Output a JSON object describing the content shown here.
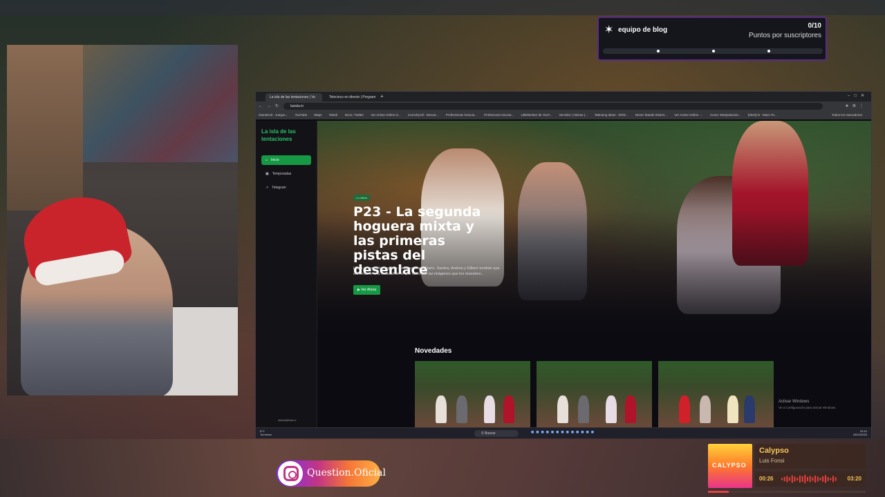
{
  "points_widget": {
    "title": "equipo de blog",
    "count": "0/10",
    "subtitle": "Puntos por suscriptores",
    "star_icon": "star-icon"
  },
  "browser": {
    "tabs": [
      {
        "label": "La isla de las tentaciones | Ve",
        "active": true
      },
      {
        "label": "Telecinco en directo | Program",
        "active": false
      }
    ],
    "url": "lasisla.tv",
    "bookmarks": [
      "GameKult - Juegos...",
      "YouTube",
      "Maps",
      "Twitch",
      "Inicio / Twitter",
      "Ver Anime Online G...",
      "Crunchyroll - Descar...",
      "Professional Associa...",
      "Profesional Associa...",
      "LittleWorker de YouT...",
      "Servidor | Alienas |...",
      "Tattooing Ideas - DIVE...",
      "Never Stands Sisters...",
      "Ver Anime Online -...",
      "Curso: Manipulación...",
      "[2024] D - Mazo To..."
    ],
    "bookmarks_right": "Todos los marcadores"
  },
  "site": {
    "brand": "La isla de las tentaciones",
    "nav": [
      {
        "label": "Inicio",
        "active": true,
        "icon": "home-icon"
      },
      {
        "label": "Temporadas",
        "active": false,
        "icon": "film-icon"
      },
      {
        "label": "Telegram",
        "active": false,
        "icon": "external-link-icon"
      }
    ],
    "footer": "lasisla@lista.tv",
    "hero": {
      "badge": "Lo último",
      "title": "P23 - La segunda hoguera mixta y las primeras pistas del desenlace",
      "description": "Llega la segunda hoguera mixta en la que Darío, Sandra, Andrea y Gilbert tendrán que enfrentarse a la realidad de lo que desvelen las imágenes que les muestren...",
      "button": "Ver Ahora"
    },
    "section_title": "Novedades"
  },
  "windows_activation": {
    "title": "Activar Windows",
    "subtitle": "Ve a Configuración para activar Windows."
  },
  "taskbar": {
    "weather_temp": "8°C",
    "weather_desc": "Tormenta",
    "search_placeholder": "Buscar",
    "time": "22:12",
    "date": "29/12/2023"
  },
  "instagram": {
    "handle": "Question.Oficial"
  },
  "player": {
    "song": "Calypso",
    "artist": "Luis Fonsi",
    "album_art_text": "CALYPSO",
    "current_time": "00:26",
    "duration": "03:20",
    "progress": 0.13
  },
  "colors": {
    "accent_green": "#169845",
    "brand_green": "#29c26a",
    "widget_border": "#5a2a8a",
    "player_gold": "#f3c55c"
  }
}
